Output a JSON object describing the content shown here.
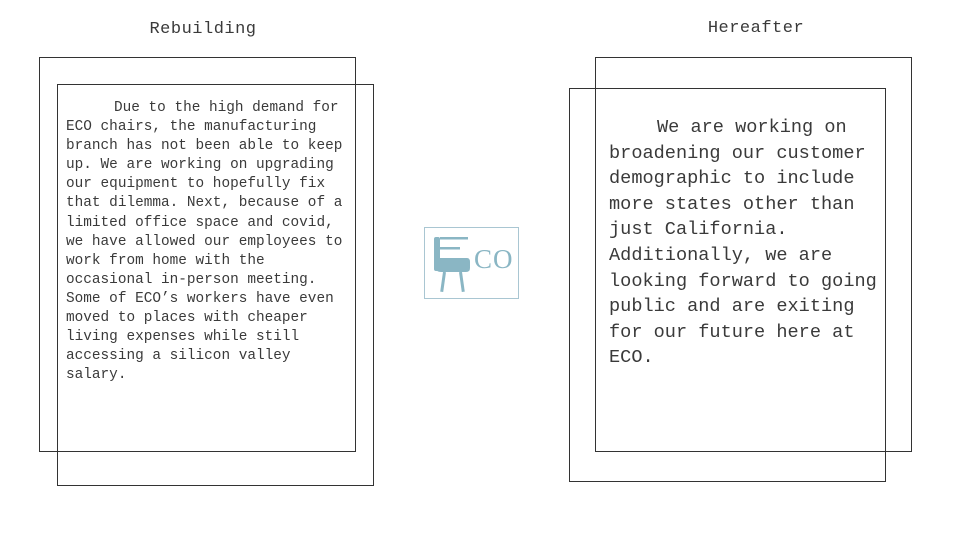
{
  "left_panel": {
    "title": "Rebuilding",
    "body": "Due to the high demand for ECO chairs, the manufacturing branch has not been able to keep up. We are working on upgrading our equipment to hopefully fix that dilemma. Next, because of a limited office space and covid, we have allowed our employees to work from home with the occasional in-person meeting.  Some of ECO’s workers have even moved to places with cheaper living expenses while still accessing a silicon valley salary."
  },
  "right_panel": {
    "title": "Hereafter",
    "body": "We are working on broadening our customer demographic to include more states other than just California. Additionally, we are looking forward to going public and are exiting for our future here at ECO."
  },
  "logo": {
    "text": "CO",
    "icon": "chair-icon",
    "color": "#8ab6c4",
    "border_color": "#a9c6d2"
  }
}
